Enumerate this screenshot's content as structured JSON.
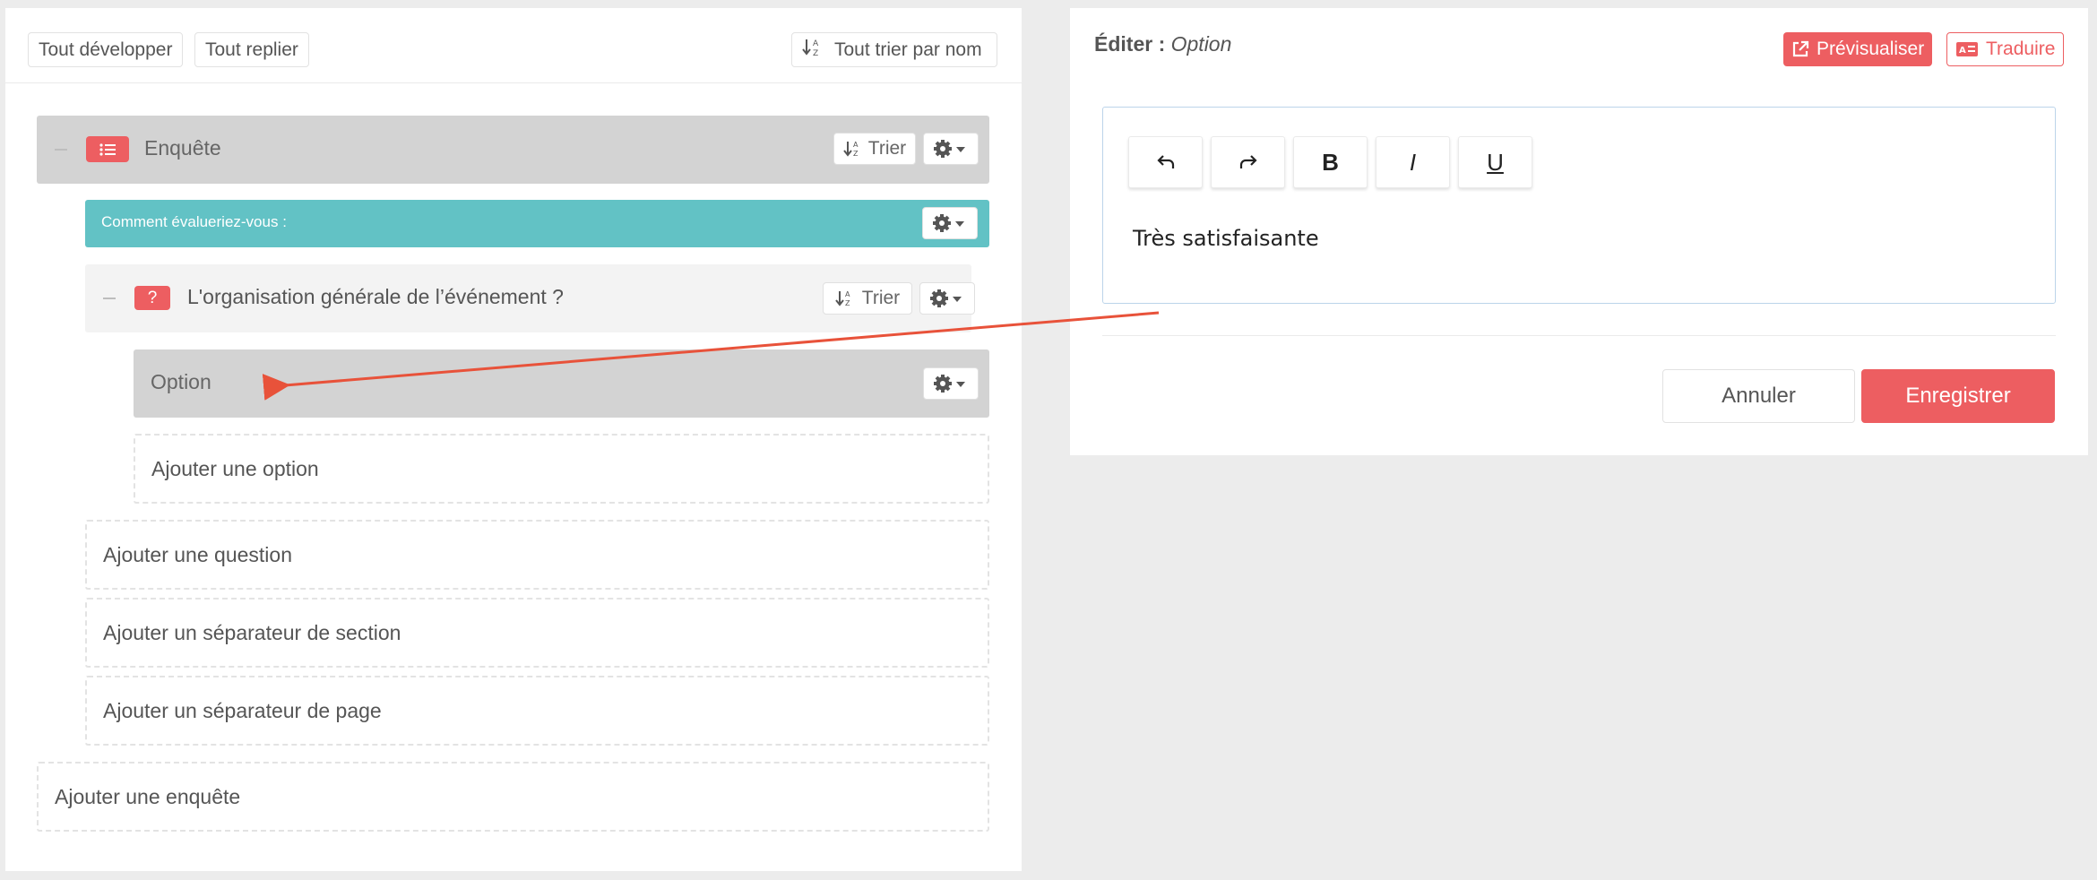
{
  "toolbar": {
    "expand_all": "Tout développer",
    "collapse_all": "Tout replier",
    "sort_all": "Tout trier par nom"
  },
  "tree": {
    "survey": {
      "title": "Enquête",
      "sort_label": "Trier"
    },
    "intro": {
      "text": "Comment évalueriez-vous :"
    },
    "question": {
      "badge": "?",
      "title": "L'organisation générale de l’événement ?",
      "sort_label": "Trier"
    },
    "option": {
      "title": "Option"
    },
    "add_option": "Ajouter une option",
    "add_question": "Ajouter une question",
    "add_section_separator": "Ajouter un séparateur de section",
    "add_page_separator": "Ajouter un séparateur de page",
    "add_survey": "Ajouter une enquête"
  },
  "edit_panel": {
    "title_prefix": "Éditer :",
    "title_item": "Option",
    "preview_label": "Prévisualiser",
    "translate_label": "Traduire",
    "editor_toolbar": {
      "bold": "B",
      "italic": "I",
      "underline": "U"
    },
    "content": "Très satisfaisante",
    "cancel_label": "Annuler",
    "save_label": "Enregistrer"
  },
  "colors": {
    "accent_red": "#ed5e61",
    "teal": "#62c2c5",
    "annotation_arrow": "#e8523a"
  }
}
